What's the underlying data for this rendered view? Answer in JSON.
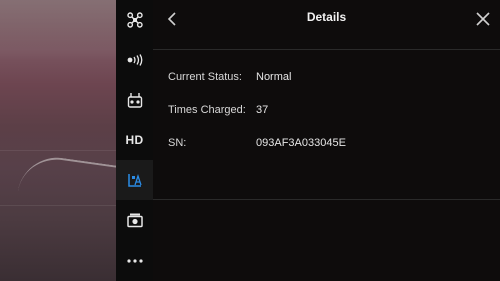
{
  "header": {
    "title": "Details",
    "back_icon": "chevron-left-icon",
    "close_icon": "close-icon"
  },
  "sidebar": {
    "items": [
      {
        "icon": "aircraft-icon",
        "label": ""
      },
      {
        "icon": "signal-icon",
        "label": ""
      },
      {
        "icon": "remote-controller-icon",
        "label": ""
      },
      {
        "icon": "hd-icon",
        "label": "HD"
      },
      {
        "icon": "battery-icon",
        "label": "",
        "active": true,
        "color": "#2b8ce6"
      },
      {
        "icon": "camera-icon",
        "label": ""
      },
      {
        "icon": "more-icon",
        "label": ""
      }
    ]
  },
  "details": {
    "rows": [
      {
        "label": "Current Status:",
        "value": "Normal"
      },
      {
        "label": "Times Charged:",
        "value": "37"
      },
      {
        "label": "SN:",
        "value": "093AF3A033045E"
      }
    ]
  },
  "colors": {
    "accent": "#2b8ce6",
    "panel_bg": "#0e0c0c",
    "sidebar_bg": "#0c0c0c"
  }
}
